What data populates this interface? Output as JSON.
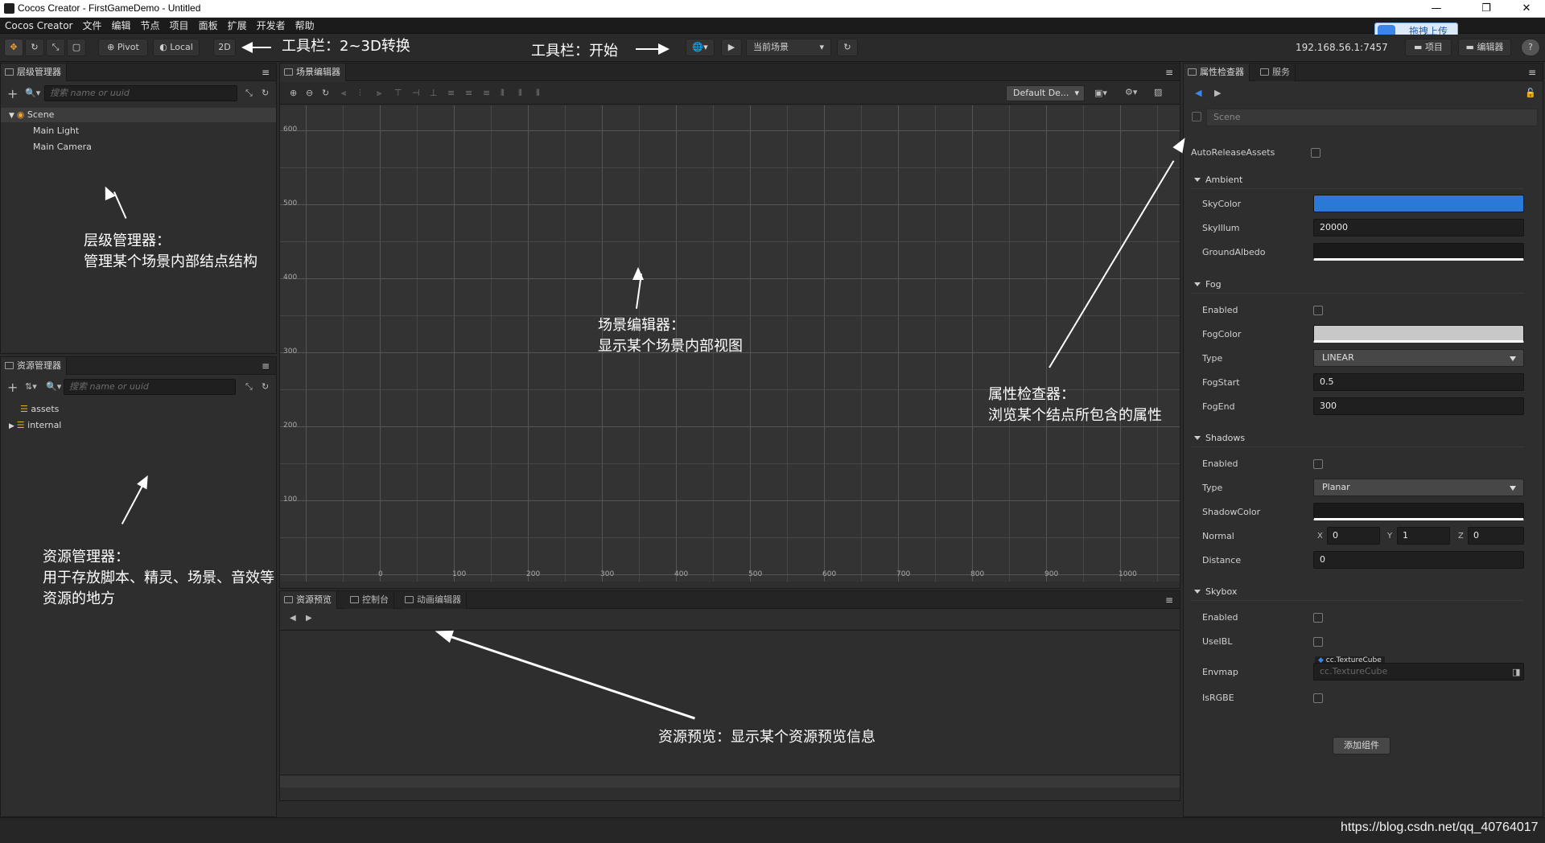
{
  "window": {
    "title": "Cocos Creator - FirstGameDemo - Untitled"
  },
  "upload_badge": "拖拽上传",
  "menu": [
    "Cocos Creator",
    "文件",
    "编辑",
    "节点",
    "项目",
    "面板",
    "扩展",
    "开发者",
    "帮助"
  ],
  "toolbar": {
    "pivot": "Pivot",
    "local": "Local",
    "mode2d": "2D",
    "scene_select": "当前场景",
    "ip": "192.168.56.1:7457",
    "project": "项目",
    "editor": "编辑器",
    "help": "?"
  },
  "annotations": {
    "toolbar_3d": "工具栏：2~3D转换",
    "toolbar_start": "工具栏：开始",
    "hierarchy_title": "层级管理器：",
    "hierarchy_desc": "管理某个场景内部结点结构",
    "scene_title": "场景编辑器：",
    "scene_desc": "显示某个场景内部视图",
    "inspector_title": "属性检查器：",
    "inspector_desc": "浏览某个结点所包含的属性",
    "assets_title": "资源管理器：",
    "assets_desc": "用于存放脚本、精灵、场景、音效等资源的地方",
    "preview": "资源预览：显示某个资源预览信息"
  },
  "hierarchy": {
    "tab": "层级管理器",
    "search_placeholder": "搜索 name or uuid",
    "items": [
      "Scene",
      "Main Light",
      "Main Camera"
    ]
  },
  "assets": {
    "tab": "资源管理器",
    "search_placeholder": "搜索 name or uuid",
    "items": [
      "assets",
      "internal"
    ]
  },
  "scene": {
    "tab": "场景编辑器",
    "camera_select": "Default De...",
    "y_labels": [
      "600",
      "500",
      "400",
      "300",
      "200",
      "100"
    ],
    "x_labels": [
      "0",
      "100",
      "200",
      "300",
      "400",
      "500",
      "600",
      "700",
      "800",
      "900",
      "1000"
    ]
  },
  "bottom": {
    "tabs": [
      "资源预览",
      "控制台",
      "动画编辑器"
    ]
  },
  "inspector": {
    "tabs": [
      "属性检查器",
      "服务"
    ],
    "node_name": "Scene",
    "auto_release": "AutoReleaseAssets",
    "sections": {
      "ambient": "Ambient",
      "fog": "Fog",
      "shadows": "Shadows",
      "skybox": "Skybox"
    },
    "ambient": {
      "sky_color_label": "SkyColor",
      "sky_color": "#2a78d8",
      "sky_illum_label": "SkyIllum",
      "sky_illum": "20000",
      "ground_albedo_label": "GroundAlbedo"
    },
    "fog": {
      "enabled_label": "Enabled",
      "fog_color_label": "FogColor",
      "fog_color": "#c8c8c8",
      "type_label": "Type",
      "type": "LINEAR",
      "start_label": "FogStart",
      "start": "0.5",
      "end_label": "FogEnd",
      "end": "300"
    },
    "shadows": {
      "enabled_label": "Enabled",
      "type_label": "Type",
      "type": "Planar",
      "color_label": "ShadowColor",
      "normal_label": "Normal",
      "normal_x": "0",
      "normal_y": "1",
      "normal_z": "0",
      "distance_label": "Distance",
      "distance": "0"
    },
    "skybox": {
      "enabled_label": "Enabled",
      "use_ibl_label": "UseIBL",
      "envmap_label": "Envmap",
      "envmap_tag": "cc.TextureCube",
      "envmap_placeholder": "cc.TextureCube",
      "is_rgbe_label": "IsRGBE"
    },
    "add_component": "添加组件"
  },
  "watermark": "https://blog.csdn.net/qq_40764017"
}
